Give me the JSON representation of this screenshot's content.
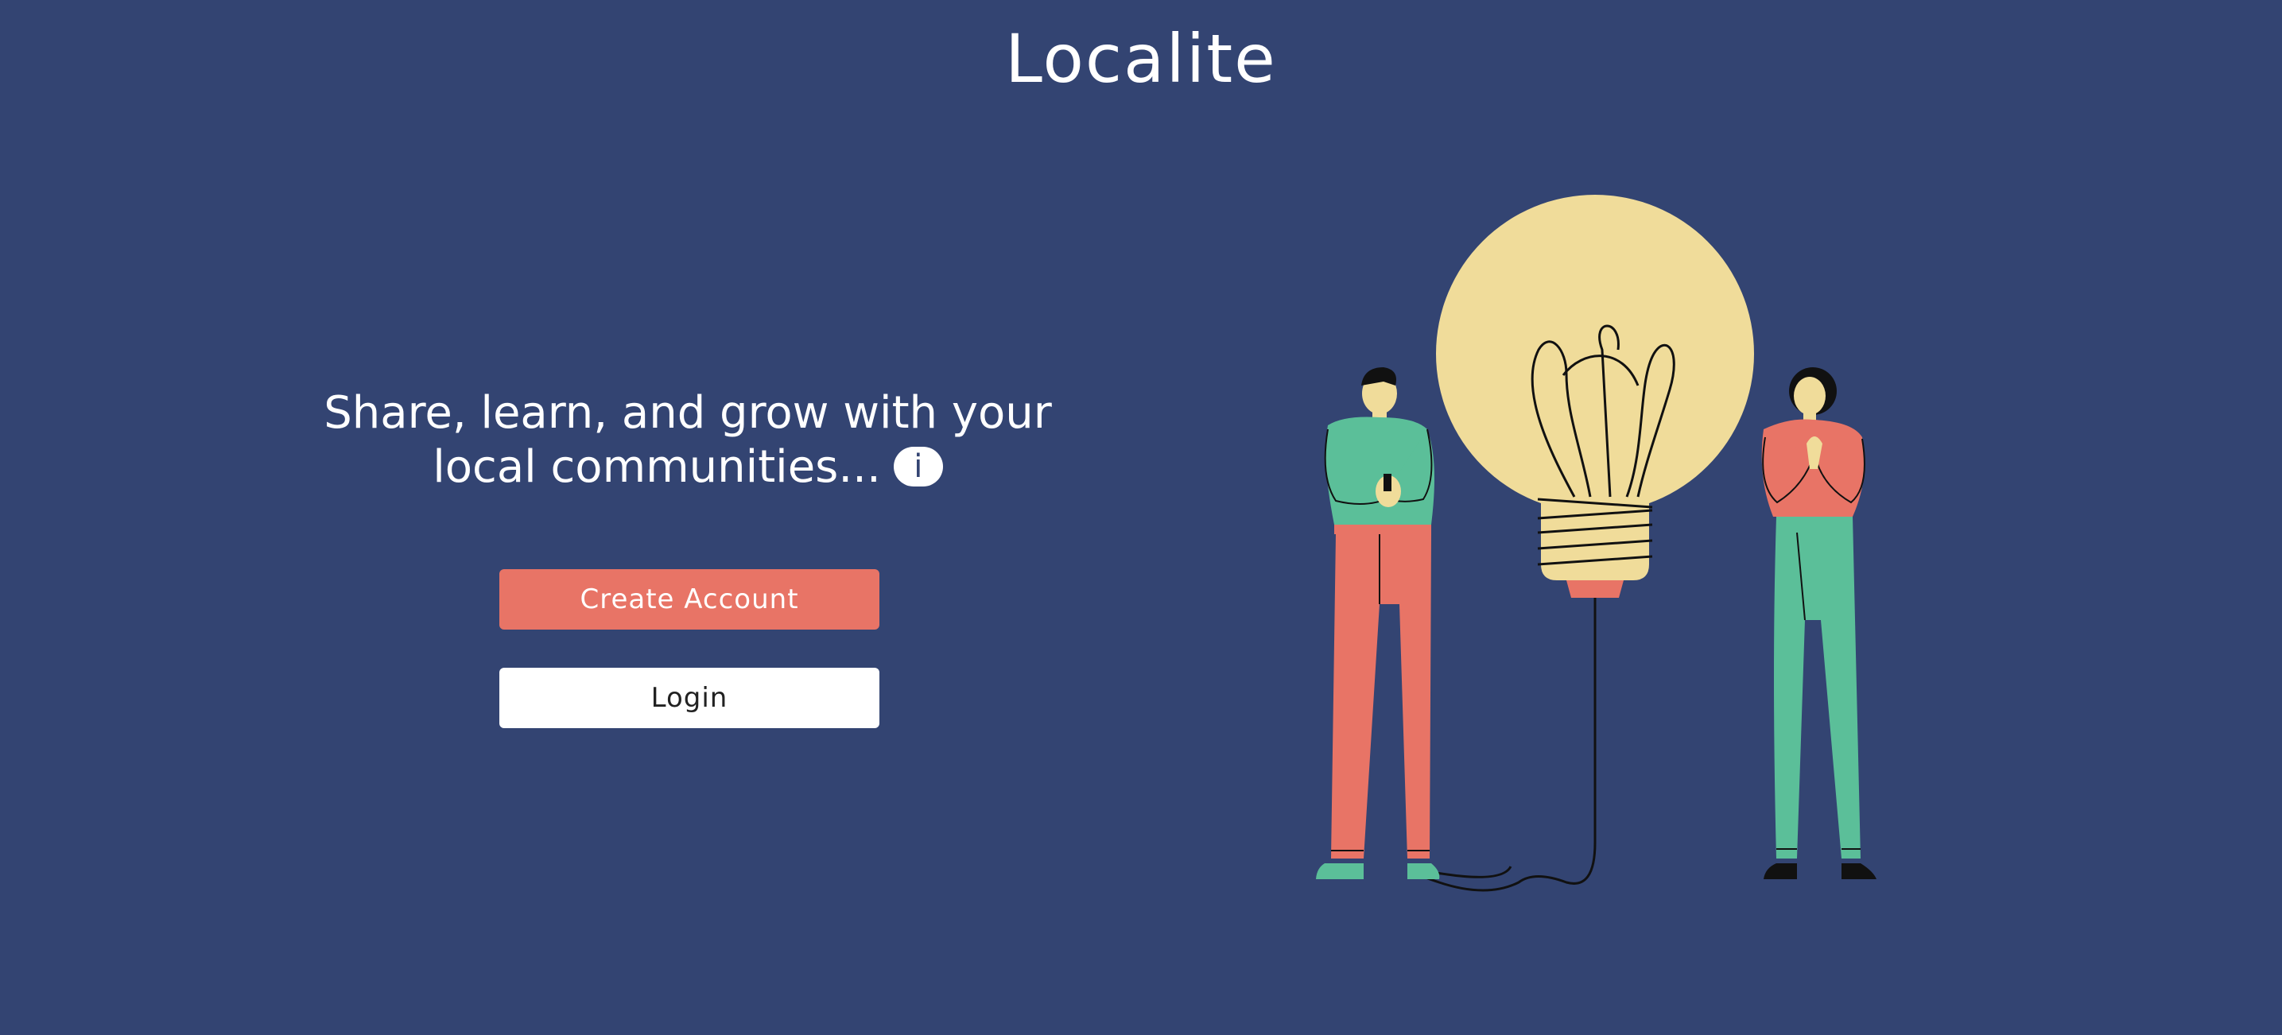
{
  "header": {
    "title": "Localite"
  },
  "hero": {
    "tagline_line1": "Share, learn, and grow with your",
    "tagline_line2": "local communities...",
    "info_glyph": "i"
  },
  "actions": {
    "create_account_label": "Create Account",
    "login_label": "Login"
  },
  "illustration": {
    "description_icon": "lightbulb-with-two-people-icon"
  },
  "colors": {
    "background": "#334472",
    "accent": "#e87466",
    "bulb": "#f0dc9a",
    "green": "#5bbf99",
    "text": "#ffffff"
  }
}
